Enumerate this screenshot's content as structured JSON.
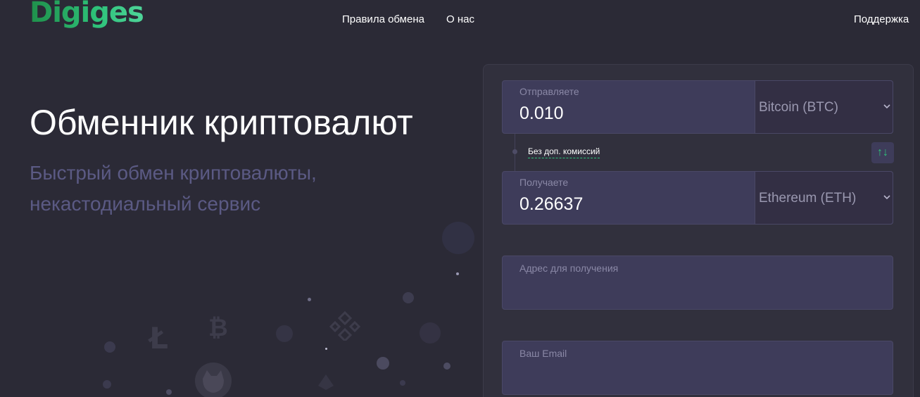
{
  "header": {
    "logo": "Digiges",
    "nav": {
      "rules": "Правила обмена",
      "about": "О нас",
      "support": "Поддержка"
    }
  },
  "hero": {
    "title": "Обменник криптовалют",
    "subtitle": "Быстрый обмен криптовалюты, некастодиальный сервис"
  },
  "exchange": {
    "send": {
      "label": "Отправляете",
      "amount": "0.010",
      "currency": "Bitcoin (BTC)"
    },
    "fee_note": "Без доп. комиссий",
    "swap_icon": "swap-arrows-icon",
    "receive": {
      "label": "Получаете",
      "amount": "0.26637",
      "currency": "Ethereum (ETH)"
    },
    "address": {
      "placeholder": "Адрес для получения"
    },
    "email": {
      "placeholder": "Ваш Email"
    }
  },
  "colors": {
    "background": "#2b2a36",
    "card": "#31303d",
    "field": "#3e3c5a",
    "accent_green": "#2ec27a",
    "subtitle": "#5b5a84"
  }
}
